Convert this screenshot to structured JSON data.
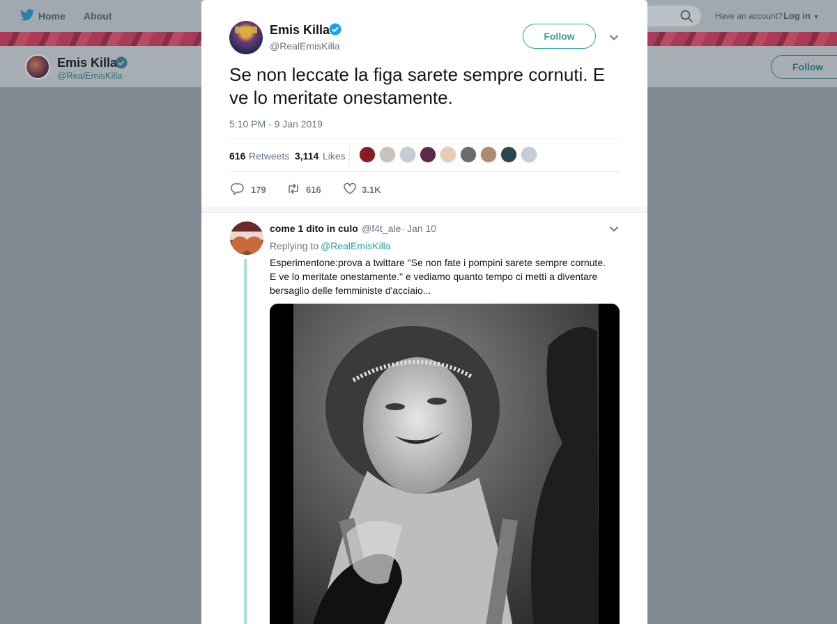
{
  "nav": {
    "home_label": "Home",
    "about_label": "About",
    "have_account": "Have an account?",
    "login_label": "Log in"
  },
  "profile": {
    "name": "Emis Killa",
    "handle": "@RealEmisKilla",
    "follow_label": "Follow"
  },
  "tweet": {
    "author_name": "Emis Killa",
    "author_handle": "@RealEmisKilla",
    "follow_label": "Follow",
    "text": "Se non leccate la figa sarete sempre cornuti. E ve lo meritate onestamente.",
    "timestamp": "5:10 PM - 9 Jan 2019",
    "retweets_count": "616",
    "retweets_label": "Retweets",
    "likes_count": "3,114",
    "likes_label": "Likes",
    "likers": [
      {
        "color": "#8b1a22"
      },
      {
        "color": "#c9c2bd"
      },
      {
        "color": "#c5ccd3"
      },
      {
        "color": "#5a2a4a"
      },
      {
        "color": "#e8cbb5"
      },
      {
        "color": "#6e6a68"
      },
      {
        "color": "#b08a6e"
      },
      {
        "color": "#2c4550"
      },
      {
        "color": "#c5ccd3"
      }
    ],
    "actions": {
      "replies": "179",
      "retweets": "616",
      "likes": "3.1K"
    }
  },
  "reply": {
    "author_name": "come 1 dito in culo",
    "author_handle": "@f4t_ale",
    "separator": "·",
    "date": "Jan 10",
    "replying_prefix": "Replying to",
    "replying_to": "@RealEmisKilla",
    "text": "Esperimentone:prova a twittare \"Se non fate i pompini sarete sempre cornute. E ve lo meritate onestamente.\" e vediamo quanto tempo ci metti a diventare bersaglio delle femministe d'acciaio..."
  },
  "colors": {
    "accent": "#2aa39c",
    "verified": "#1da1f2",
    "secondary_text": "#657786"
  }
}
